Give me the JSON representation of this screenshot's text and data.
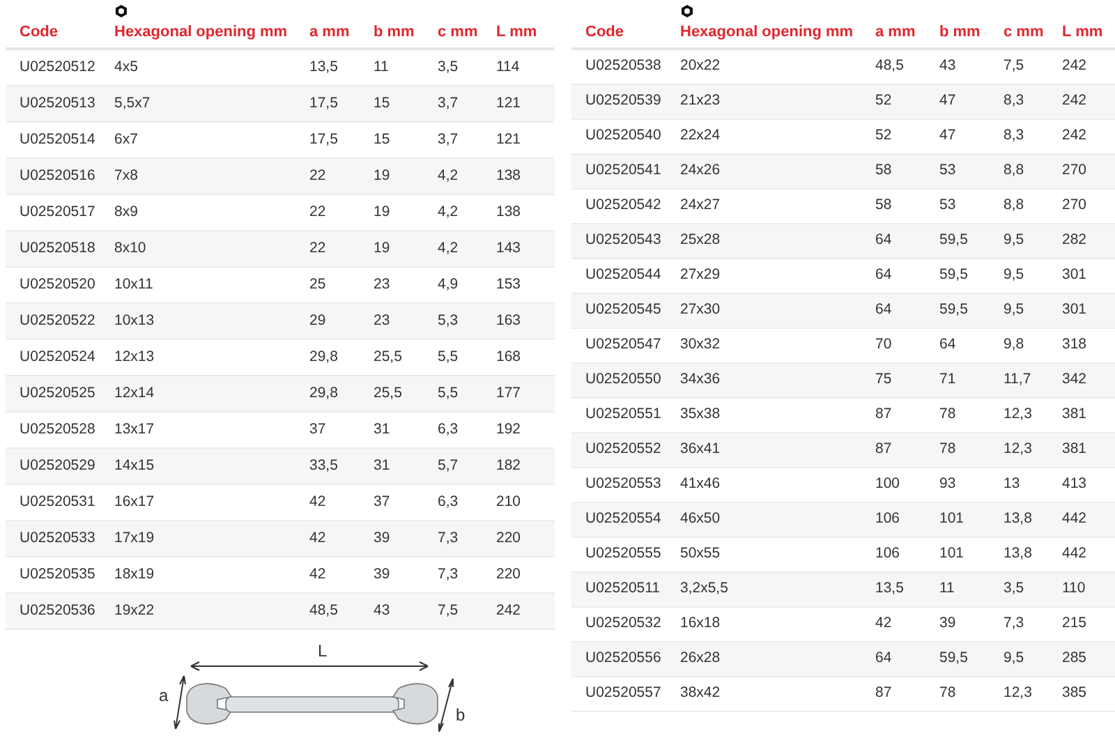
{
  "tables": [
    {
      "columns": [
        "Code",
        "Hexagonal opening mm",
        "a mm",
        "b mm",
        "c mm",
        "L mm"
      ],
      "rows": [
        [
          "U02520512",
          "4x5",
          "13,5",
          "11",
          "3,5",
          "114"
        ],
        [
          "U02520513",
          "5,5x7",
          "17,5",
          "15",
          "3,7",
          "121"
        ],
        [
          "U02520514",
          "6x7",
          "17,5",
          "15",
          "3,7",
          "121"
        ],
        [
          "U02520516",
          "7x8",
          "22",
          "19",
          "4,2",
          "138"
        ],
        [
          "U02520517",
          "8x9",
          "22",
          "19",
          "4,2",
          "138"
        ],
        [
          "U02520518",
          "8x10",
          "22",
          "19",
          "4,2",
          "143"
        ],
        [
          "U02520520",
          "10x11",
          "25",
          "23",
          "4,9",
          "153"
        ],
        [
          "U02520522",
          "10x13",
          "29",
          "23",
          "5,3",
          "163"
        ],
        [
          "U02520524",
          "12x13",
          "29,8",
          "25,5",
          "5,5",
          "168"
        ],
        [
          "U02520525",
          "12x14",
          "29,8",
          "25,5",
          "5,5",
          "177"
        ],
        [
          "U02520528",
          "13x17",
          "37",
          "31",
          "6,3",
          "192"
        ],
        [
          "U02520529",
          "14x15",
          "33,5",
          "31",
          "5,7",
          "182"
        ],
        [
          "U02520531",
          "16x17",
          "42",
          "37",
          "6,3",
          "210"
        ],
        [
          "U02520533",
          "17x19",
          "42",
          "39",
          "7,3",
          "220"
        ],
        [
          "U02520535",
          "18x19",
          "42",
          "39",
          "7,3",
          "220"
        ],
        [
          "U02520536",
          "19x22",
          "48,5",
          "43",
          "7,5",
          "242"
        ]
      ]
    },
    {
      "columns": [
        "Code",
        "Hexagonal opening mm",
        "a mm",
        "b mm",
        "c mm",
        "L mm"
      ],
      "rows": [
        [
          "U02520538",
          "20x22",
          "48,5",
          "43",
          "7,5",
          "242"
        ],
        [
          "U02520539",
          "21x23",
          "52",
          "47",
          "8,3",
          "242"
        ],
        [
          "U02520540",
          "22x24",
          "52",
          "47",
          "8,3",
          "242"
        ],
        [
          "U02520541",
          "24x26",
          "58",
          "53",
          "8,8",
          "270"
        ],
        [
          "U02520542",
          "24x27",
          "58",
          "53",
          "8,8",
          "270"
        ],
        [
          "U02520543",
          "25x28",
          "64",
          "59,5",
          "9,5",
          "282"
        ],
        [
          "U02520544",
          "27x29",
          "64",
          "59,5",
          "9,5",
          "301"
        ],
        [
          "U02520545",
          "27x30",
          "64",
          "59,5",
          "9,5",
          "301"
        ],
        [
          "U02520547",
          "30x32",
          "70",
          "64",
          "9,8",
          "318"
        ],
        [
          "U02520550",
          "34x36",
          "75",
          "71",
          "11,7",
          "342"
        ],
        [
          "U02520551",
          "35x38",
          "87",
          "78",
          "12,3",
          "381"
        ],
        [
          "U02520552",
          "36x41",
          "87",
          "78",
          "12,3",
          "381"
        ],
        [
          "U02520553",
          "41x46",
          "100",
          "93",
          "13",
          "413"
        ],
        [
          "U02520554",
          "46x50",
          "106",
          "101",
          "13,8",
          "442"
        ],
        [
          "U02520555",
          "50x55",
          "106",
          "101",
          "13,8",
          "442"
        ],
        [
          "U02520511",
          "3,2x5,5",
          "13,5",
          "11",
          "3,5",
          "110"
        ],
        [
          "U02520532",
          "16x18",
          "42",
          "39",
          "7,3",
          "215"
        ],
        [
          "U02520556",
          "26x28",
          "64",
          "59,5",
          "9,5",
          "285"
        ],
        [
          "U02520557",
          "38x42",
          "87",
          "78",
          "12,3",
          "385"
        ]
      ]
    }
  ],
  "diagram": {
    "length_label": "L",
    "a_label": "a",
    "b_label": "b"
  }
}
